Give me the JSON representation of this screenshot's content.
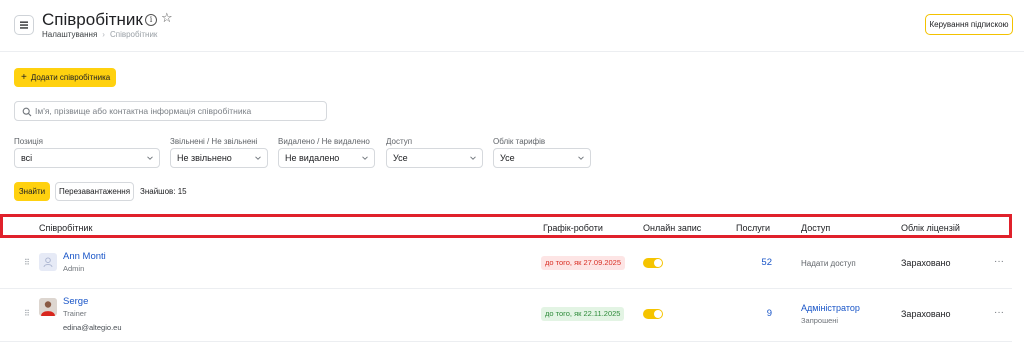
{
  "header": {
    "title": "Співробітник",
    "breadcrumb_root": "Налаштування",
    "breadcrumb_current": "Співробітник",
    "subscription_button": "Керування підпискою"
  },
  "actions": {
    "add_employee": "Додати співробітника"
  },
  "search": {
    "placeholder": "Ім'я, прізвище або контактна інформація співробітника",
    "value": ""
  },
  "filters": [
    {
      "label": "Позиція",
      "value": "всі"
    },
    {
      "label": "Звільнені / Не звільнені",
      "value": "Не звільнено"
    },
    {
      "label": "Видалено / Не видалено",
      "value": "Не видалено"
    },
    {
      "label": "Доступ",
      "value": "Усе"
    },
    {
      "label": "Облік тарифів",
      "value": "Усе"
    }
  ],
  "find": {
    "find_button": "Знайти",
    "reload_button": "Перезавантаження",
    "found_text": "Знайшов: 15"
  },
  "table": {
    "columns": {
      "employee": "Співробітник",
      "schedule": "Графік-роботи",
      "online_booking": "Онлайн запис",
      "services": "Послуги",
      "access": "Доступ",
      "license": "Облік ліцензій"
    },
    "rows": [
      {
        "name": "Ann Monti",
        "role": "Admin",
        "email": "",
        "schedule_badge": "до того, як 27.09.2025",
        "schedule_status": "red",
        "online_booking": true,
        "services": "52",
        "access_link": "Надати доступ",
        "access_role": "",
        "access_status": "",
        "license": "Зараховано"
      },
      {
        "name": "Serge",
        "role": "Trainer",
        "email": "edina@altegio.eu",
        "schedule_badge": "до того, як 22.11.2025",
        "schedule_status": "green",
        "online_booking": true,
        "services": "9",
        "access_link": "",
        "access_role": "Адміністратор",
        "access_status": "Запрошені",
        "license": "Зараховано"
      }
    ]
  },
  "colors": {
    "accent_yellow": "#ffd10f",
    "link_blue": "#1a56c8",
    "highlight_red": "#e0212b"
  }
}
